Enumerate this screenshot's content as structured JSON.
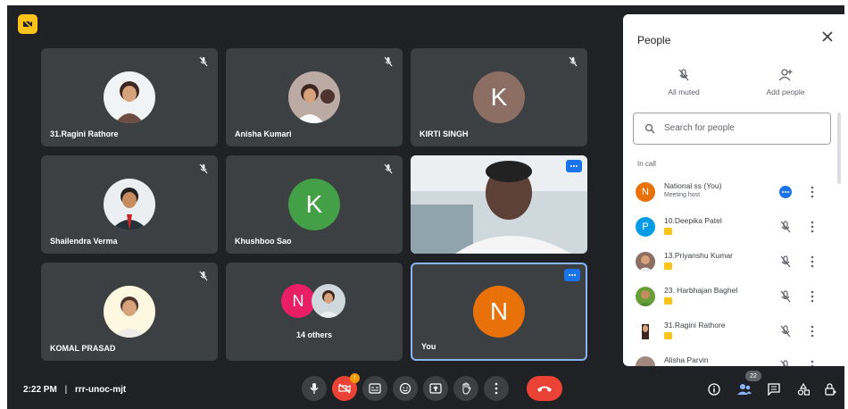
{
  "colors": {
    "background": "#202124",
    "tile": "#3c4043",
    "accent": "#1a73e8",
    "end_call": "#ea4335",
    "badge": "#f9c31a"
  },
  "tiles": [
    {
      "name": "31.Ragini Rathore",
      "avatar": "photo",
      "muted": true
    },
    {
      "name": "Anisha Kumari",
      "avatar": "photo",
      "muted": true
    },
    {
      "name": "KIRTI SINGH",
      "avatar_letter": "K",
      "avatar_color": "#8d6e63",
      "muted": true
    },
    {
      "name": "Shailendra Verma",
      "avatar": "photo",
      "muted": true
    },
    {
      "name": "Khushboo Sao",
      "avatar_letter": "K",
      "avatar_color": "#43a047",
      "muted": true
    },
    {
      "name": "",
      "avatar": "video",
      "muted": false
    },
    {
      "name": "KOMAL PRASAD",
      "avatar": "photo",
      "muted": true
    },
    {
      "name": "14 others",
      "avatar_letter": "N",
      "avatar_color": "#e91e63"
    },
    {
      "name": "You",
      "avatar_letter": "N",
      "avatar_color": "#e8710a"
    }
  ],
  "people_panel": {
    "title": "People",
    "all_muted_label": "All muted",
    "add_people_label": "Add people",
    "search_placeholder": "Search for people",
    "in_call_label": "In call",
    "participants": [
      {
        "name": "National ss (You)",
        "subtitle": "Meeting host",
        "avatar_letter": "N",
        "avatar_color": "#e8710a"
      },
      {
        "name": "10.Deepika Patel",
        "avatar_letter": "P",
        "avatar_color": "#039be5"
      },
      {
        "name": "13.Priyanshu Kumar",
        "avatar": "photo"
      },
      {
        "name": "23. Harbhajan Baghel",
        "avatar": "photo"
      },
      {
        "name": "31.Ragini Rathore",
        "avatar": "photo"
      },
      {
        "name": "Alisha Parvin",
        "avatar": "photo"
      }
    ]
  },
  "bottom_bar": {
    "time": "2:22 PM",
    "separator": "|",
    "meeting_code": "rrr-unoc-mjt",
    "camera_notification": "!",
    "people_count": "22"
  },
  "icons": [
    "mic-icon",
    "camera-off-icon",
    "captions-icon",
    "emoji-icon",
    "present-icon",
    "raise-hand-icon",
    "more-options-icon",
    "end-call-icon",
    "info-icon",
    "people-icon",
    "chat-icon",
    "activities-icon",
    "host-controls-icon"
  ]
}
